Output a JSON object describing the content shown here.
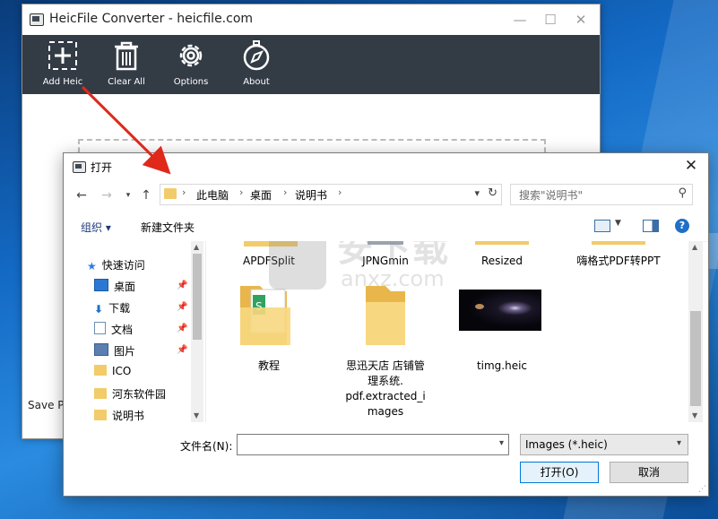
{
  "main_window": {
    "title": "HeicFile Converter - heicfile.com",
    "toolbar": [
      {
        "label": "Add Heic",
        "icon": "add-file-icon"
      },
      {
        "label": "Clear All",
        "icon": "trash-icon"
      },
      {
        "label": "Options",
        "icon": "gear-icon"
      },
      {
        "label": "About",
        "icon": "compass-icon"
      }
    ],
    "save_label": "Save Pa"
  },
  "dialog": {
    "title": "打开",
    "breadcrumb": [
      "此电脑",
      "桌面",
      "说明书"
    ],
    "search_placeholder": "搜索\"说明书\"",
    "organize": "组织 ▾",
    "new_folder": "新建文件夹",
    "nav_items": [
      {
        "label": "快速访问",
        "icon": "star-icon"
      },
      {
        "label": "桌面",
        "icon": "desktop-icon",
        "pinned": true
      },
      {
        "label": "下载",
        "icon": "download-icon",
        "pinned": true
      },
      {
        "label": "文档",
        "icon": "document-icon",
        "pinned": true
      },
      {
        "label": "图片",
        "icon": "picture-icon",
        "pinned": true
      },
      {
        "label": "ICO",
        "icon": "folder-icon"
      },
      {
        "label": "河东软件园",
        "icon": "folder-icon"
      },
      {
        "label": "说明书",
        "icon": "folder-icon"
      }
    ],
    "files_top": [
      "APDFSplit",
      "JPNGmin",
      "Resized",
      "嗨格式PDF转PPT"
    ],
    "files": [
      {
        "name": "教程",
        "type": "folder"
      },
      {
        "name": "思迅天店 店铺管理系统.pdf.extracted_images",
        "type": "folder"
      },
      {
        "name": "timg.heic",
        "type": "image"
      }
    ],
    "file_label_lines": [
      "思迅天店 店铺管",
      "理系统.",
      "pdf.extracted_i",
      "mages"
    ],
    "filename_label": "文件名(N):",
    "filename_value": "",
    "filetype": "Images (*.heic)",
    "open_button": "打开(O)",
    "cancel_button": "取消"
  },
  "watermark": {
    "text": "安下载",
    "sub": "anxz.com"
  },
  "colors": {
    "toolbar_bg": "#333b45",
    "accent": "#0078d7",
    "folder": "#f2cc6a",
    "arrow": "#e0281b"
  }
}
